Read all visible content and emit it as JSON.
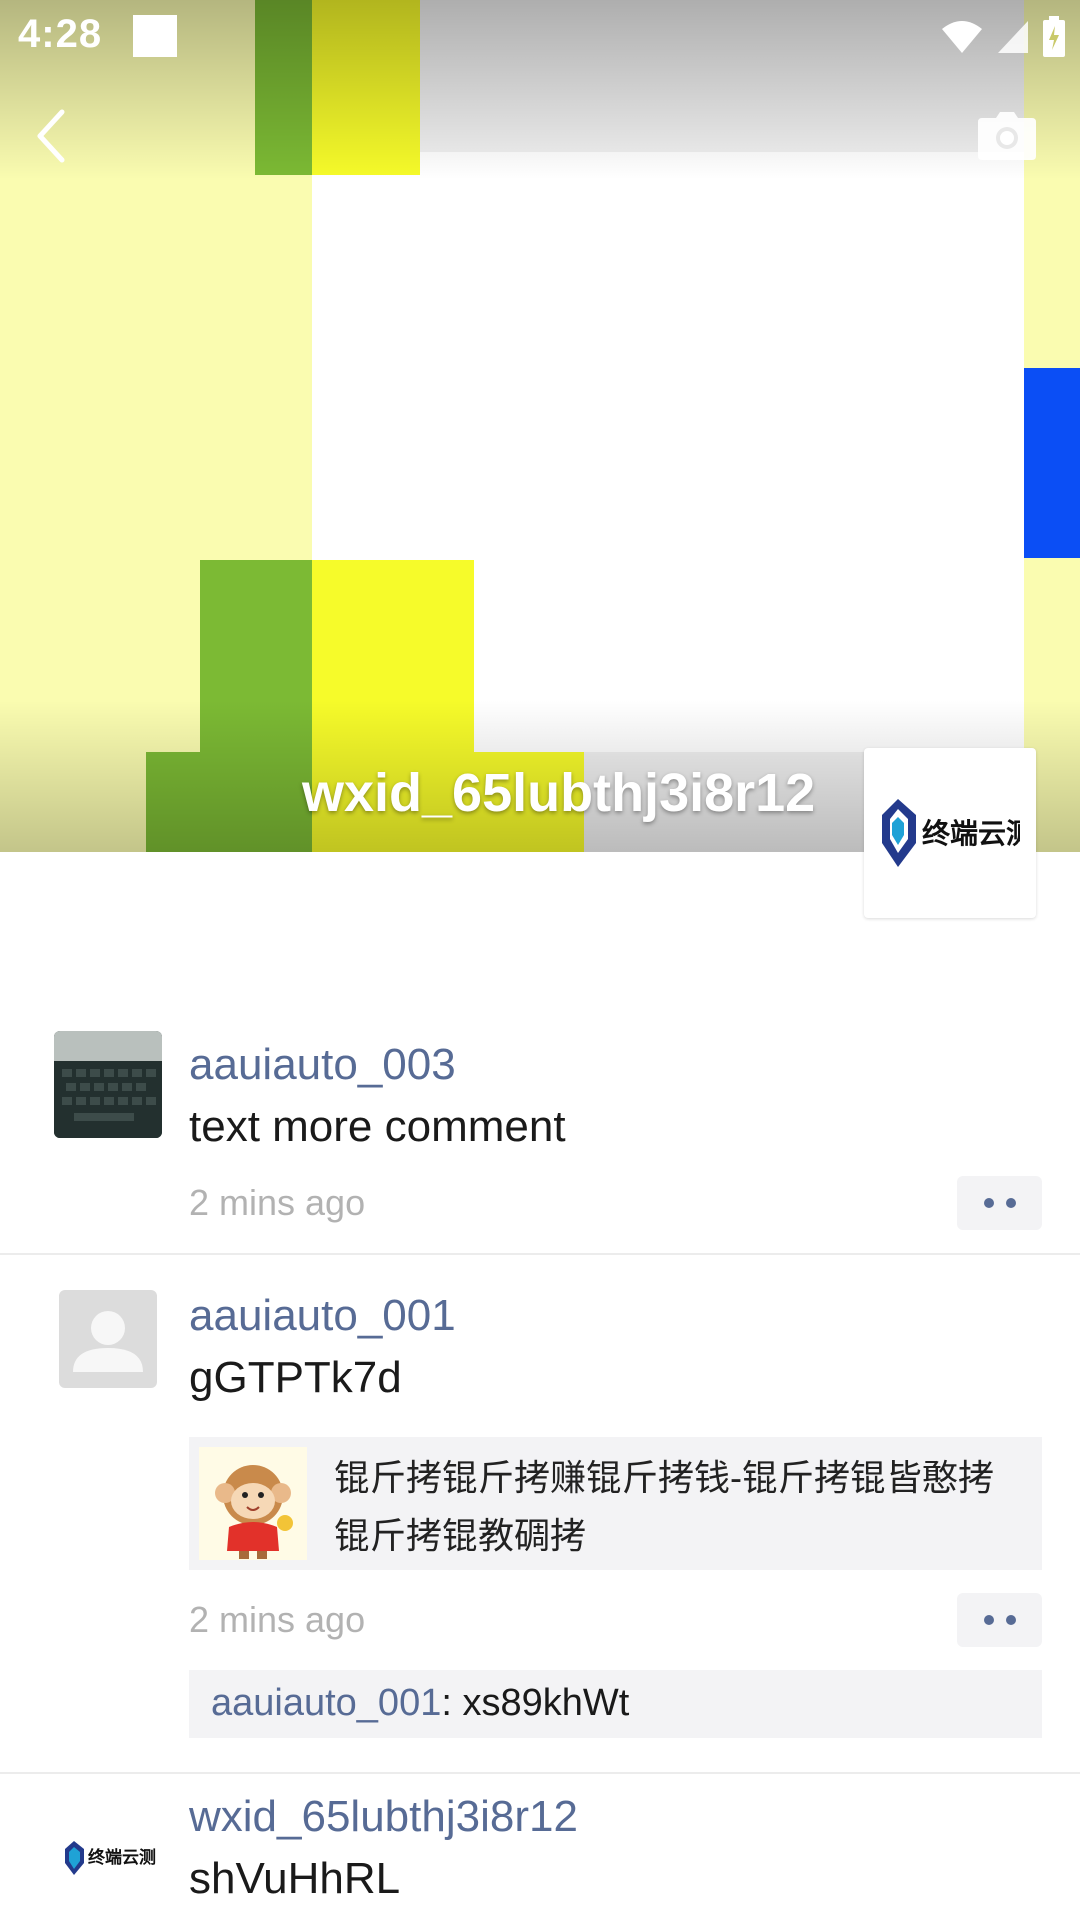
{
  "status_bar": {
    "time": "4:28"
  },
  "profile": {
    "name": "wxid_65lubthj3i8r12",
    "logo_text": "终端云测"
  },
  "colors": {
    "link": "#576b95",
    "green": "#7cba34",
    "yellow": "#f6fb2a",
    "pale_yellow": "#fafcb0",
    "blue": "#0b4ef5"
  },
  "posts": [
    {
      "username": "aauiauto_003",
      "text": "text more comment",
      "timestamp": "2 mins ago"
    },
    {
      "username": "aauiauto_001",
      "text": "gGTPTk7d",
      "share_title": "锟斤拷锟斤拷赚锟斤拷钱-锟斤拷锟皆憨拷锟斤拷锟教碉拷",
      "timestamp": "2 mins ago",
      "comment": {
        "user": "aauiauto_001",
        "sep": ": ",
        "text": "xs89khWt"
      }
    },
    {
      "username": "wxid_65lubthj3i8r12",
      "text": "shVuHhRL",
      "avatar_logo": "终端云测"
    }
  ]
}
